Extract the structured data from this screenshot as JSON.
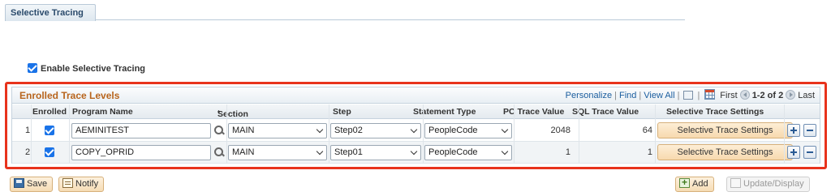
{
  "tab": {
    "label": "Selective Tracing"
  },
  "enable": {
    "label": "Enable Selective Tracing",
    "checked": true
  },
  "grid": {
    "title": "Enrolled Trace Levels",
    "nav": {
      "personalize": "Personalize",
      "find": "Find",
      "view_all": "View All",
      "first": "First",
      "range": "1-2 of 2",
      "last": "Last"
    },
    "columns": {
      "enrolled": "Enrolled",
      "program": "Program Name",
      "section_req": "*",
      "section": "Section",
      "step": "Step",
      "stype": "Statement Type",
      "pc": "PC Trace Value",
      "sql": "SQL Trace Value",
      "settings": "Selective Trace Settings"
    },
    "rows": [
      {
        "num": "1",
        "enrolled": true,
        "program": "AEMINITEST",
        "section": "MAIN",
        "step": "Step02",
        "stype": "PeopleCode",
        "pc": "2048",
        "sql": "64",
        "button": "Selective Trace Settings"
      },
      {
        "num": "2",
        "enrolled": true,
        "program": "COPY_OPRID",
        "section": "MAIN",
        "step": "Step01",
        "stype": "PeopleCode",
        "pc": "1",
        "sql": "1",
        "button": "Selective Trace Settings"
      }
    ]
  },
  "footer": {
    "save": "Save",
    "notify": "Notify",
    "add": "Add",
    "update": "Update/Display"
  },
  "colors": {
    "highlight_frame": "#e8331c",
    "title": "#b8651d",
    "link": "#1a5d9e",
    "button": "#f7d9ae"
  }
}
